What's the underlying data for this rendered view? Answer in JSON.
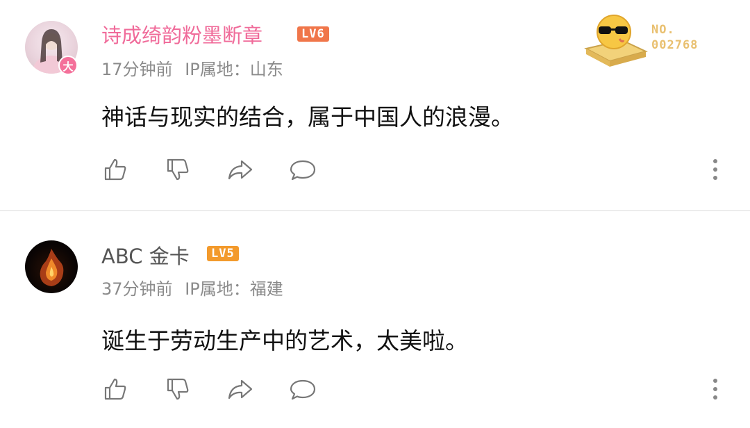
{
  "comments": [
    {
      "username": "诗成绮韵粉墨断章",
      "level": "LV6",
      "avatar_badge": "大",
      "time": "17分钟前",
      "ip_label": "IP属地：",
      "ip_location": "山东",
      "content": "神话与现实的结合，属于中国人的浪漫。",
      "fan_badge": {
        "line1": "NO.",
        "line2": "002768"
      }
    },
    {
      "username": "ABC 金卡",
      "level": "LV5",
      "time": "37分钟前",
      "ip_label": "IP属地：",
      "ip_location": "福建",
      "content": "诞生于劳动生产中的艺术，太美啦。"
    }
  ],
  "icons": {
    "actions": [
      "thumbs-up-icon",
      "thumbs-down-icon",
      "share-icon",
      "comment-bubble-icon"
    ],
    "more": "more-vertical-icon"
  },
  "colors": {
    "username_vip": "#f06b9a",
    "lv6_badge": "#f0764a",
    "lv5_badge": "#f39a2c",
    "meta_text": "#8b8b8b",
    "fan_badge_text": "#e9c070"
  }
}
